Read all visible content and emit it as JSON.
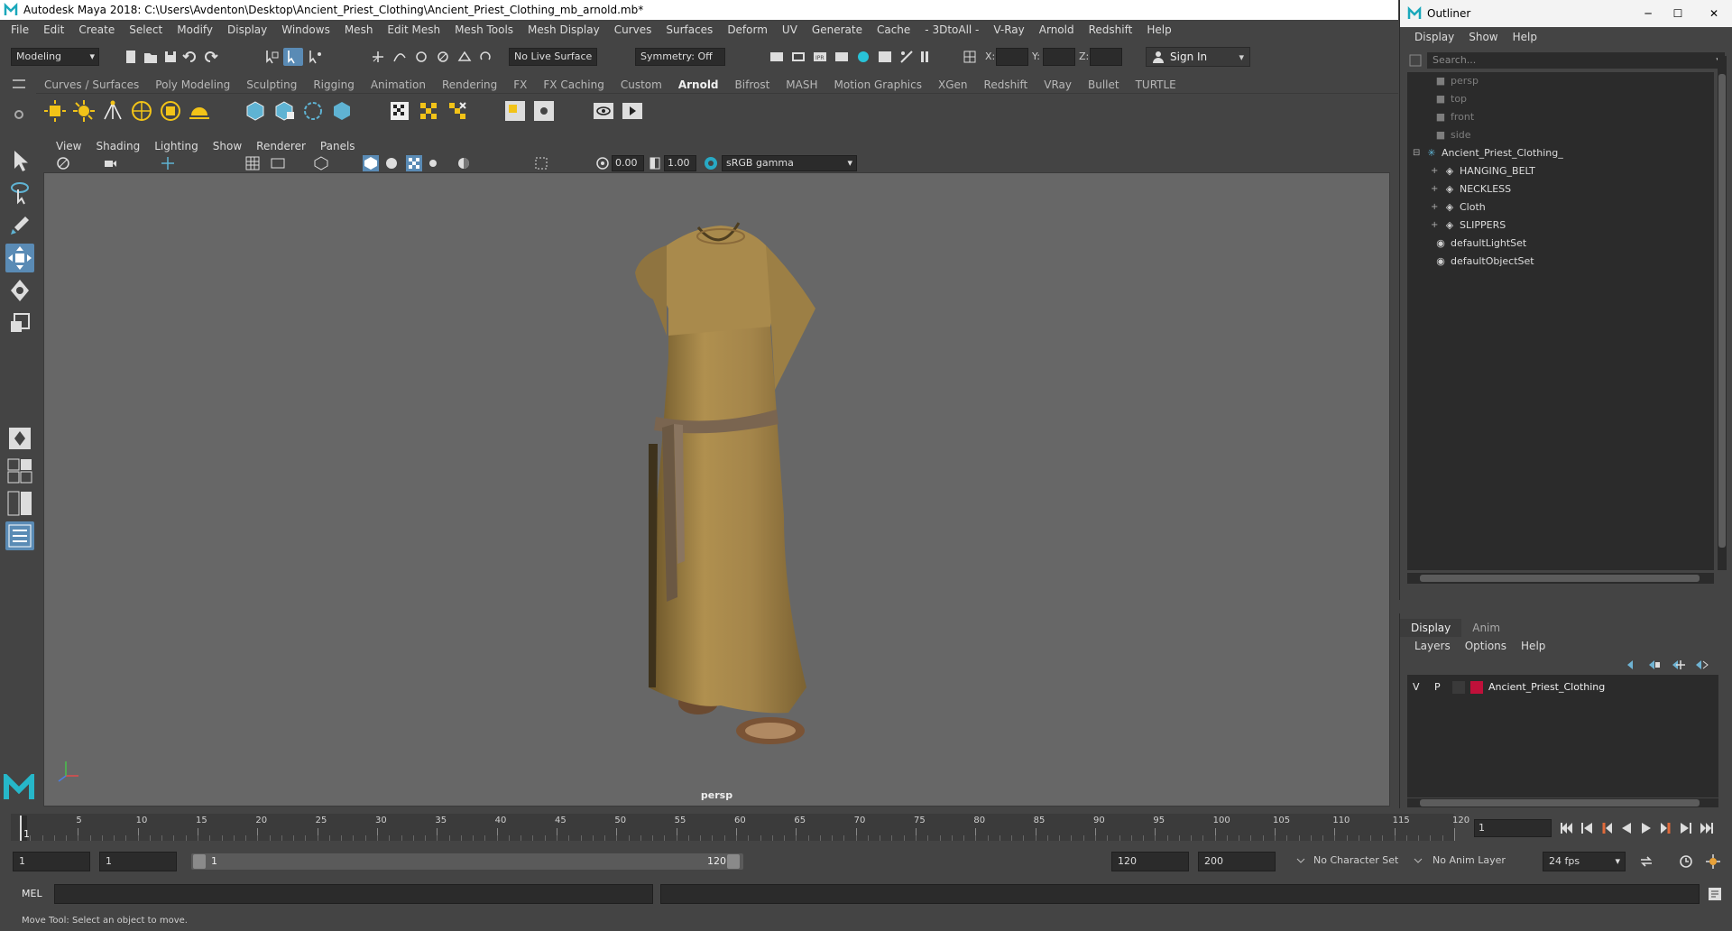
{
  "window": {
    "title": "Autodesk Maya 2018: C:\\Users\\Avdenton\\Desktop\\Ancient_Priest_Clothing\\Ancient_Priest_Clothing_mb_arnold.mb*"
  },
  "menubar": [
    "File",
    "Edit",
    "Create",
    "Select",
    "Modify",
    "Display",
    "Windows",
    "Mesh",
    "Edit Mesh",
    "Mesh Tools",
    "Mesh Display",
    "Curves",
    "Surfaces",
    "Deform",
    "UV",
    "Generate",
    "Cache",
    "- 3DtoAll -",
    "V-Ray",
    "Arnold",
    "Redshift",
    "Help"
  ],
  "statusline": {
    "mode": "Modeling",
    "live_surface": "No Live Surface",
    "symmetry": "Symmetry: Off",
    "x_label": "X:",
    "y_label": "Y:",
    "z_label": "Z:",
    "sign_in": "Sign In"
  },
  "shelf": {
    "tabs": [
      "Curves / Surfaces",
      "Poly Modeling",
      "Sculpting",
      "Rigging",
      "Animation",
      "Rendering",
      "FX",
      "FX Caching",
      "Custom",
      "Arnold",
      "Bifrost",
      "MASH",
      "Motion Graphics",
      "XGen",
      "Redshift",
      "VRay",
      "Bullet",
      "TURTLE"
    ],
    "active_tab": "Arnold"
  },
  "viewport": {
    "menu": [
      "View",
      "Shading",
      "Lighting",
      "Show",
      "Renderer",
      "Panels"
    ],
    "exposure": "0.00",
    "gamma": "1.00",
    "color_space": "sRGB gamma",
    "camera": "persp"
  },
  "timeline": {
    "ticks": [
      "5",
      "10",
      "15",
      "20",
      "25",
      "30",
      "35",
      "40",
      "45",
      "50",
      "55",
      "60",
      "65",
      "70",
      "75",
      "80",
      "85",
      "90",
      "95",
      "100",
      "105",
      "110",
      "115",
      "120"
    ],
    "current_marker": "1",
    "current_frame": "1"
  },
  "range": {
    "start": "1",
    "playback_start": "1",
    "slider_start": "1",
    "slider_end": "120",
    "playback_end": "120",
    "end": "200",
    "character_set": "No Character Set",
    "anim_layer": "No Anim Layer",
    "fps": "24 fps"
  },
  "command_line": {
    "label": "MEL"
  },
  "help_line": "Move Tool: Select an object to move.",
  "outliner": {
    "title": "Outliner",
    "menu": [
      "Display",
      "Show",
      "Help"
    ],
    "search_placeholder": "Search...",
    "items": [
      {
        "label": "persp"
      },
      {
        "label": "top"
      },
      {
        "label": "front"
      },
      {
        "label": "side"
      },
      {
        "label": "Ancient_Priest_Clothing_"
      },
      {
        "label": "HANGING_BELT"
      },
      {
        "label": "NECKLESS"
      },
      {
        "label": "Cloth"
      },
      {
        "label": "SLIPPERS"
      },
      {
        "label": "defaultLightSet"
      },
      {
        "label": "defaultObjectSet"
      }
    ]
  },
  "layer_editor": {
    "tabs": [
      "Display",
      "Anim"
    ],
    "menu": [
      "Layers",
      "Options",
      "Help"
    ],
    "layer": {
      "v": "V",
      "p": "P",
      "name": "Ancient_Priest_Clothing",
      "color": "#c0103a"
    }
  },
  "colors": {
    "selected_tool": "#5a8bb5",
    "maya_logo": "#26b7c9",
    "robe": "#a8884a",
    "belt": "#7a6550"
  }
}
